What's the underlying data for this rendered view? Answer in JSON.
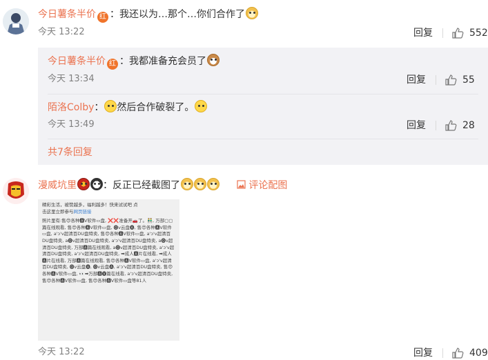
{
  "comments": [
    {
      "user": "今日薯条半价",
      "badge": "红",
      "text": "：我还以为…那个…你们合作了",
      "time": "今天 13:22",
      "reply_label": "回复",
      "likes": "552"
    },
    {
      "user": "漫威坑里",
      "text": "：反正已经截图了",
      "pic_label": "评论配图",
      "time": "今天 13:22",
      "reply_label": "回复",
      "likes": "409"
    }
  ],
  "replies": [
    {
      "user": "今日薯条半价",
      "badge": "红",
      "text": "：我都准备充会员了",
      "time": "今天 13:34",
      "reply_label": "回复",
      "likes": "55"
    },
    {
      "user": "陌洛Colby",
      "text_a": "：",
      "text_b": "然后合作破裂了。",
      "time": "今天 13:49",
      "reply_label": "回复",
      "likes": "28"
    }
  ],
  "more_replies": "共7条回复",
  "screenshot_text": {
    "line1": "精彩生活，被赞越多，福利越多！快来试试吧 点",
    "line2a": "击这里立即参与",
    "line2b": "网页链接",
    "body": "照片里有:售😍各种🅰V软件▭盘, ❌❌准备开🚗了。👬, 万部▢▢篇在线观看, 售😍各种🅰V软件▭盘, 🅞v云盘🅐, 售😍各种🅰V软件▭盘, a'ↄ'v超清百DU盘特卖, 售😍各种🅰V软件▭盘, a'ↄ'v超清百DU盘特卖, a🅞v超清百DU盘特卖, a'ↄ'v超清百DU盘特卖, a🅞v超清百DU盘特卖, 万部🅰篇在线观看, a🅞v超清百DU盘特卖, a'ↄ'v超清百DU盘特卖, a'ↄ'v超清百DU盘特卖, ➡成人🅰片在线看, ➡成人🅰片在线看, 万部🅰篇在线观看, 售😍各种🅰V软件▭盘, a'ↄ'v超清百DU盘特卖, 🅞v云盘🅐, 🅞v云盘🅐, a'ↄ'v超清百DU盘特卖, 售😍各种🅰V软件▭盘, 👀➡万部🅰🅥篇在线看, a'ↄ'v超清百DU盘特卖, 售😍各种🅰V软件▭盘, 售😍各种🅰V软件▭盘等81人"
  }
}
